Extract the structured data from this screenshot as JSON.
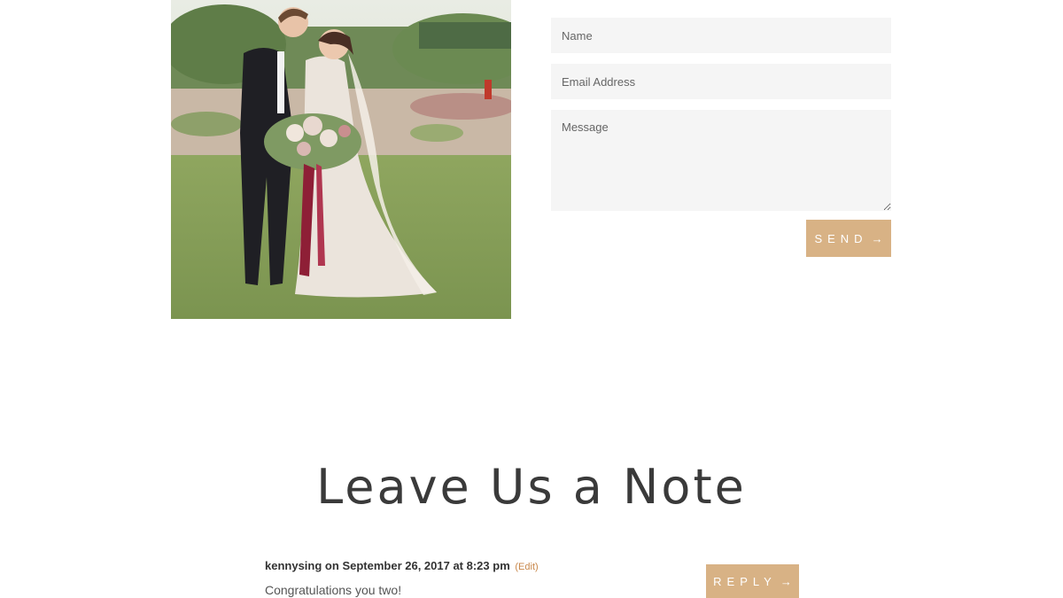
{
  "form": {
    "name_placeholder": "Name",
    "email_placeholder": "Email Address",
    "message_placeholder": "Message",
    "send_label": "SEND",
    "arrow": "→"
  },
  "section": {
    "title": "Leave Us a Note"
  },
  "comment": {
    "author": "kennysing",
    "on": "on",
    "date": "September 26, 2017 at 8:23 pm",
    "edit_label": "(Edit)",
    "text": "Congratulations you two!",
    "reply_label": "REPLY",
    "arrow": "→"
  },
  "colors": {
    "accent": "#d8b285",
    "field_bg": "#f5f5f5",
    "edit_link": "#c8874a"
  }
}
